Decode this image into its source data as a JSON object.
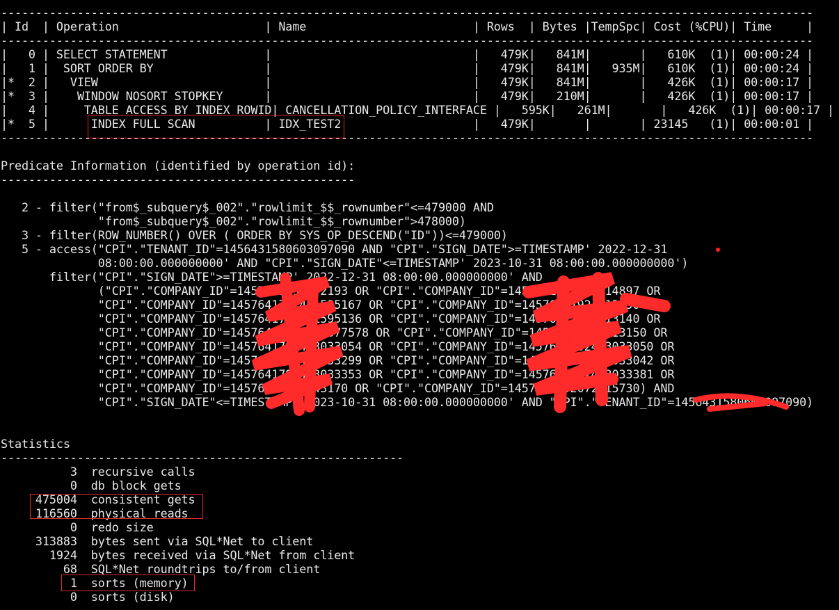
{
  "terminal": {
    "lines": [
      "---------------------------------------------------------------------------------------------------------------------",
      "| Id  | Operation                     | Name                        | Rows  | Bytes |TempSpc| Cost (%CPU)| Time     |",
      "---------------------------------------------------------------------------------------------------------------------",
      "|   0 | SELECT STATEMENT              |                             |   479K|   841M|       |   610K  (1)| 00:00:24 |",
      "|   1 |  SORT ORDER BY                |                             |   479K|   841M|   935M|   610K  (1)| 00:00:24 |",
      "|*  2 |   VIEW                        |                             |   479K|   841M|       |   426K  (1)| 00:00:17 |",
      "|*  3 |    WINDOW NOSORT STOPKEY      |                             |   479K|   210M|       |   426K  (1)| 00:00:17 |",
      "|   4 |     TABLE ACCESS BY INDEX ROWID| CANCELLATION_POLICY_INTERFACE |   595K|   261M|       |   426K  (1)| 00:00:17 |",
      "|*  5 |      INDEX FULL SCAN          | IDX_TEST2                   |   479K|       |       | 23145   (1)| 00:00:01 |",
      "---------------------------------------------------------------------------------------------------------------------",
      "",
      "Predicate Information (identified by operation id):",
      "---------------------------------------------------",
      "",
      "   2 - filter(\"from$_subquery$_002\".\"rowlimit_$$_rownumber\"<=479000 AND",
      "              \"from$_subquery$_002\".\"rowlimit_$$_rownumber\">478000)",
      "   3 - filter(ROW_NUMBER() OVER ( ORDER BY SYS_OP_DESCEND(\"ID\"))<=479000)",
      "   5 - access(\"CPI\".\"TENANT_ID\"=1456431580603097090 AND \"CPI\".\"SIGN_DATE\">=TIMESTAMP' 2022-12-31",
      "              08:00:00.000000000' AND \"CPI\".\"SIGN_DATE\"<=TIMESTAMP' 2023-10-31 08:00:00.000000000')",
      "       filter(\"CPI\".\"SIGN_DATE\">=TIMESTAMP' 2022-12-31 08:00:00.000000000' AND",
      "              (\"CPI\".\"COMPANY_ID\"=1457641792472193 OR \"CPI\".\"COMPANY_ID\"=1457641792473714897 OR",
      "              \"CPI\".\"COMPANY_ID\"=1457641792481595167 OR \"CPI\".\"COMPANY_ID\"=14576417924713190 OR",
      "              \"CPI\".\"COMPANY_ID\"=1457641792481595136 OR \"CPI\".\"COMPANY_ID\"=14576417924713140 OR",
      "              \"CPI\".\"COMPANY_ID\"=14576417924730377578 OR \"CPI\".\"COMPANY_ID\"=14576417924713150 OR",
      "              \"CPI\".\"COMPANY_ID\"=1457641792473033054 OR \"CPI\".\"COMPANY_ID\"=1457641792473033050 OR",
      "              \"CPI\".\"COMPANY_ID\"=1457641792473033299 OR \"CPI\".\"COMPANY_ID\"=1457641792473033042 OR",
      "              \"CPI\".\"COMPANY_ID\"=1457641792473033353 OR \"CPI\".\"COMPANY_ID\"=1457641792473033381 OR",
      "              \"CPI\".\"COMPANY_ID\"=14576417920043170 OR \"CPI\".\"COMPANY_ID\"=1457641792072015730) AND",
      "              \"CPI\".\"SIGN_DATE\"<=TIMESTAMP' 2023-10-31 08:00:00.000000000' AND \"CPI\".\"TENANT_ID\"=1456431580603097090)",
      "",
      "",
      "Statistics",
      "----------------------------------------------------------",
      "          3  recursive calls",
      "          0  db block gets",
      "     475004  consistent gets",
      "     116560  physical reads",
      "          0  redo size",
      "     313883  bytes sent via SQL*Net to client",
      "       1924  bytes received via SQL*Net from client",
      "         68  SQL*Net roundtrips to/from client",
      "          1  sorts (memory)",
      "          0  sorts (disk)"
    ]
  },
  "colors": {
    "background": "#000000",
    "foreground": "#e8e8e8",
    "highlight_box": "#e8262e",
    "redaction": "#ff2a2a"
  }
}
